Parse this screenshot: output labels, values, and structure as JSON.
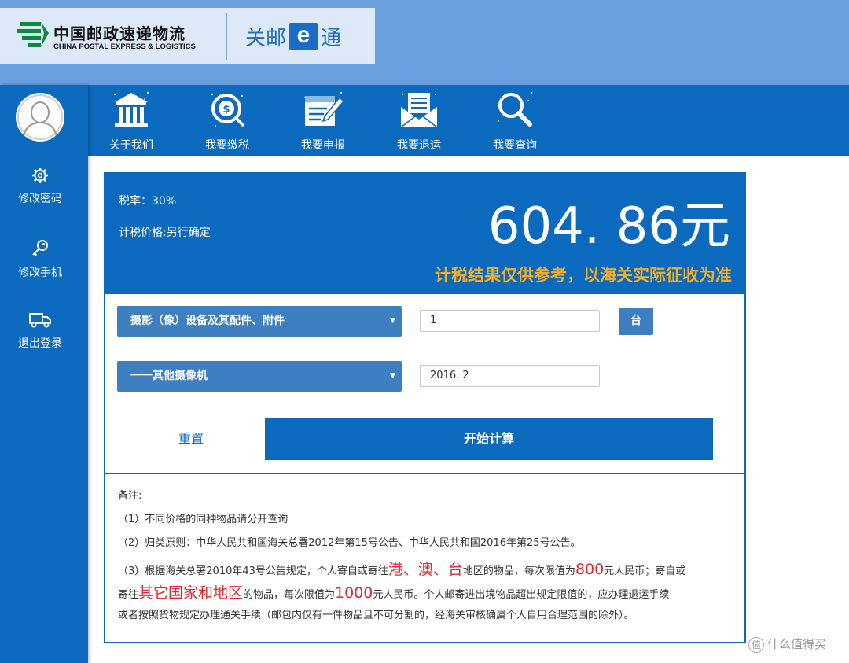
{
  "colors": {
    "primary": "#0b6abd",
    "header_band": "#6a9fdf",
    "select_bg": "#3d7fc1",
    "disclaimer": "#f2ad2a",
    "highlight_red": "#e8262c"
  },
  "header": {
    "logo_cn": "中国邮政速递物流",
    "logo_en": "CHINA POSTAL EXPRESS & LOGISTICS",
    "brand_before": "关邮",
    "brand_e": "e",
    "brand_after": "通"
  },
  "nav": [
    {
      "label": "关于我们",
      "icon": "bank-icon"
    },
    {
      "label": "我要缴税",
      "icon": "coin-icon"
    },
    {
      "label": "我要申报",
      "icon": "document-pen-icon"
    },
    {
      "label": "我要退运",
      "icon": "envelope-icon"
    },
    {
      "label": "我要查询",
      "icon": "magnifier-icon"
    }
  ],
  "sidebar": [
    {
      "label": "修改密码",
      "icon": "gear-icon"
    },
    {
      "label": "修改手机",
      "icon": "key-icon"
    },
    {
      "label": "退出登录",
      "icon": "truck-icon"
    }
  ],
  "result": {
    "rate": "税率：30%",
    "tax_price": "计税价格:另行确定",
    "amount": "604. 86元",
    "disclaimer": "计税结果仅供参考，以海关实际征收为准"
  },
  "form": {
    "category_select": "摄影（像）设备及其配件、附件",
    "subcategory_select": "一一其他摄像机",
    "quantity": "1",
    "unit": "台",
    "price": "2016. 2",
    "reset_label": "重置",
    "calculate_label": "开始计算"
  },
  "notes": {
    "title": "备注:",
    "note1": "（1）不同价格的同种物品请分开查询",
    "note2": "（2）归类原则：中华人民共和国海关总署2012年第15号公告、中华人民共和国2016年第25号公告。",
    "note3_a": "（3）根据海关总署2010年43号公告规定，个人寄自或寄往",
    "note3_red1": "港、澳、台",
    "note3_b": "地区的物品，每次限值为",
    "note3_red2": "800",
    "note3_c": "元人民币；寄自或",
    "note3_d": "寄往",
    "note3_red3": "其它国家和地区",
    "note3_e": "的物品，每次限值为",
    "note3_red4": "1000",
    "note3_f": "元人民币。个人邮寄进出境物品超出规定限值的，应办理退运手续",
    "note3_g": "或者按照货物规定办理通关手续（邮包内仅有一件物品且不可分割的，经海关审核确属个人自用合理范围的除外）。"
  },
  "watermark": {
    "badge": "值",
    "text": "什么值得买"
  }
}
